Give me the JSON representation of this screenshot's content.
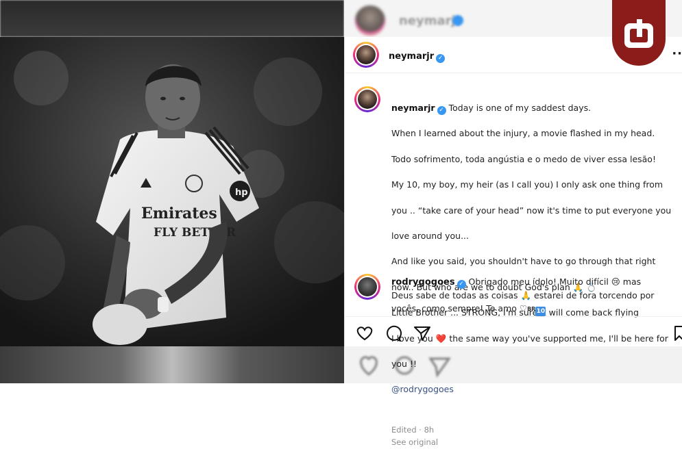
{
  "background": {
    "blurred_username": "neymarjr"
  },
  "post": {
    "username": "neymarjr",
    "verified": true,
    "caption": {
      "username": "neymarjr",
      "first_line": "Today is one of my saddest days.",
      "body_lines": [
        "When I learned about the injury, a movie flashed in my head.",
        "Todo sofrimento, toda angústia e o medo de viver essa lesão!",
        "My 10, my boy, my heir (as I call you) I only ask one thing from",
        "you .. “take care of your head” now it's time to put everyone you",
        "love around you...",
        "And like you said, you shouldn't have to go through that right",
        "now.. But who are we to doubt God's plan 🙏 💍",
        "Little Brother ... STRONG, I'm sure it will come back flying",
        "I love you ❤️ the same way you've supported me, I'll be here for",
        "you !!"
      ],
      "mention": "@rodrygogoes",
      "edited_label": "Edited · 8h",
      "see_original_label": "See original"
    },
    "comment": {
      "username": "rodrygogoes",
      "text_part1": "Obrigado meu ídolo! Muito difícil 😢 mas",
      "text_part2": "Deus sabe de todas as coisas 🙏 estarei de fora torcendo por",
      "text_part3": "vocês, como sempre! Te amo ♡",
      "flag_label": "BR",
      "number_badge": "10"
    },
    "actions": {
      "icons": [
        "heart-icon",
        "comment-icon",
        "share-icon",
        "bookmark-icon"
      ]
    }
  },
  "colors": {
    "logo": "#8b1c1a",
    "verified": "#3897f0",
    "mention": "#385185"
  }
}
